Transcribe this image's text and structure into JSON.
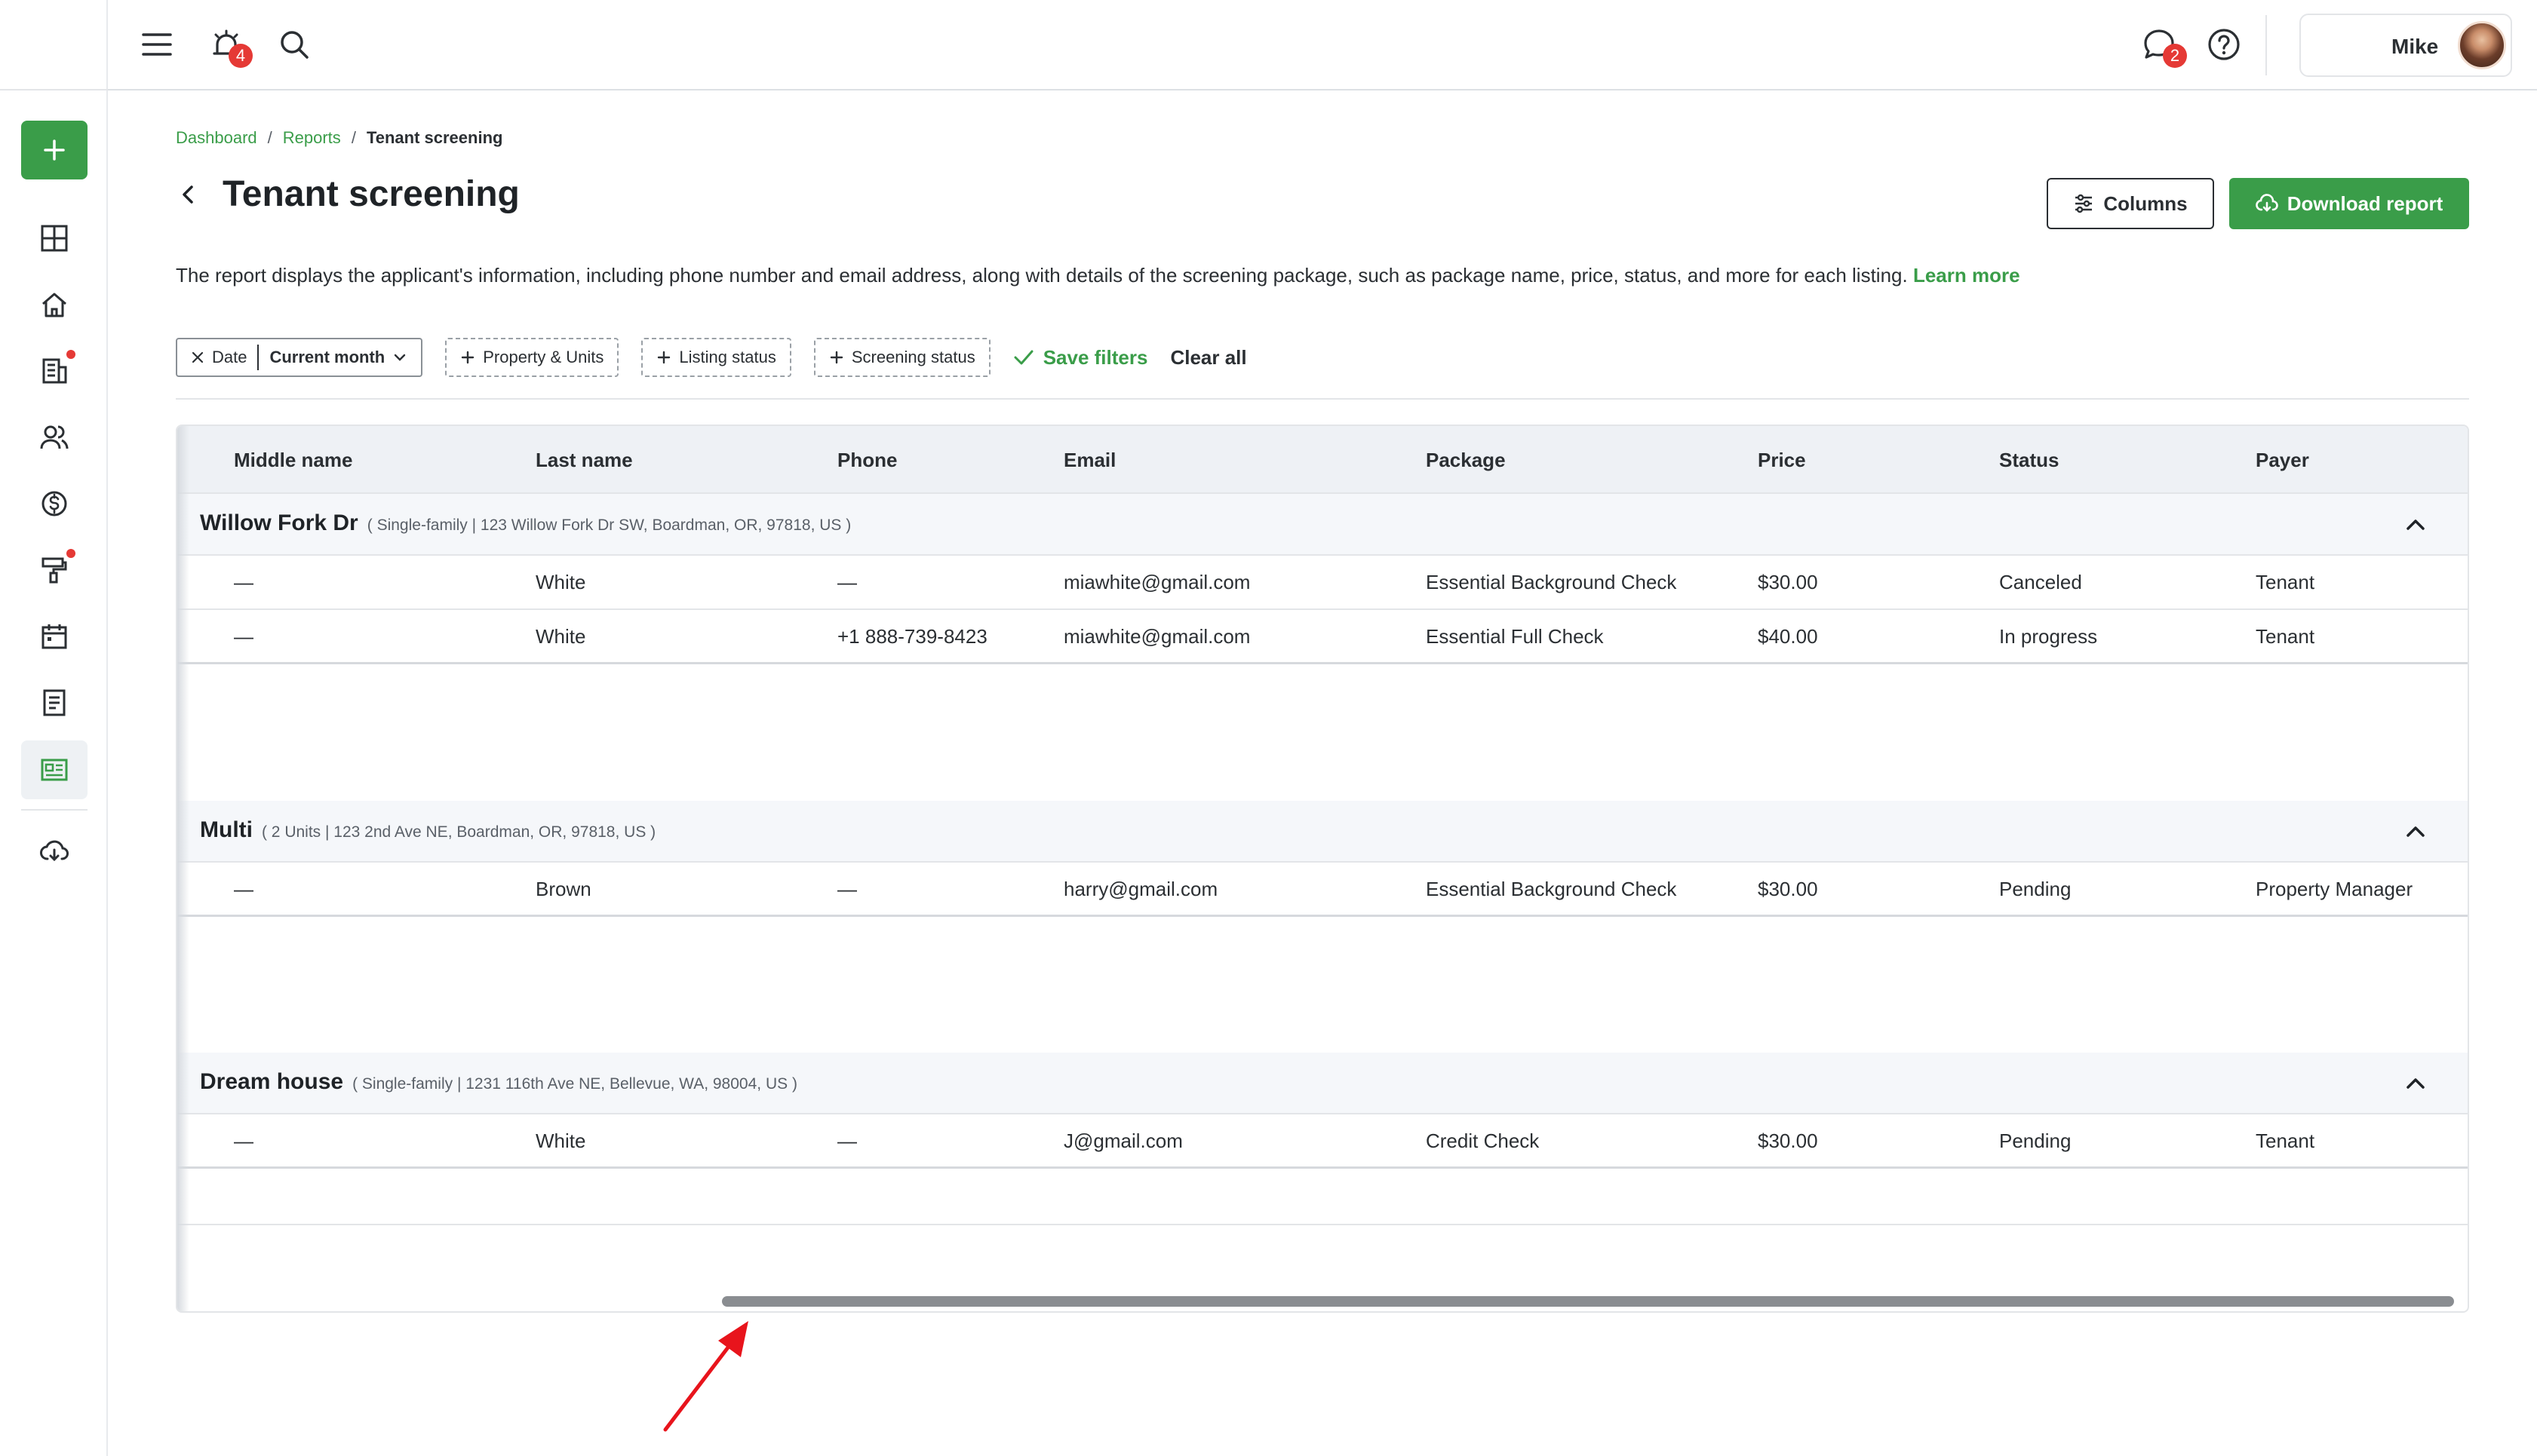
{
  "topbar": {
    "notifications_count": "4",
    "messages_count": "2",
    "user_name": "Mike"
  },
  "breadcrumb": {
    "items": [
      "Dashboard",
      "Reports",
      "Tenant screening"
    ],
    "separator": "/"
  },
  "page": {
    "title": "Tenant screening",
    "description": "The report displays the applicant's information, including phone number and email address, along with details of the screening package, such as package name, price, status, and more for each listing.",
    "learn_more": "Learn more"
  },
  "actions": {
    "columns": "Columns",
    "download": "Download report"
  },
  "filters": {
    "date_label": "Date",
    "date_value": "Current month",
    "property_units": "Property & Units",
    "listing_status": "Listing status",
    "screening_status": "Screening status",
    "save_filters": "Save filters",
    "clear_all": "Clear all"
  },
  "table": {
    "columns": [
      "Middle name",
      "Last name",
      "Phone",
      "Email",
      "Package",
      "Price",
      "Status",
      "Payer"
    ],
    "groups": [
      {
        "name": "Willow Fork Dr",
        "address": "( Single-family | 123 Willow Fork Dr SW, Boardman, OR, 97818, US )",
        "rows": [
          [
            "—",
            "White",
            "—",
            "miawhite@gmail.com",
            "Essential Background Check",
            "$30.00",
            "Canceled",
            "Tenant"
          ],
          [
            "—",
            "White",
            "+1 888-739-8423",
            "miawhite@gmail.com",
            "Essential Full Check",
            "$40.00",
            "In progress",
            "Tenant"
          ]
        ]
      },
      {
        "name": "Multi",
        "address": "( 2 Units | 123 2nd Ave NE, Boardman, OR, 97818, US )",
        "rows": [
          [
            "—",
            "Brown",
            "—",
            "harry@gmail.com",
            "Essential Background Check",
            "$30.00",
            "Pending",
            "Property Manager"
          ]
        ]
      },
      {
        "name": "Dream house",
        "address": "( Single-family | 1231 116th Ave NE, Bellevue, WA, 98004, US )",
        "rows": [
          [
            "—",
            "White",
            "—",
            "J@gmail.com",
            "Credit Check",
            "$30.00",
            "Pending",
            "Tenant"
          ]
        ]
      }
    ]
  },
  "colors": {
    "brand_green": "#3a9d49",
    "badge_red": "#e53935",
    "annotation_arrow": "#e8141c"
  }
}
